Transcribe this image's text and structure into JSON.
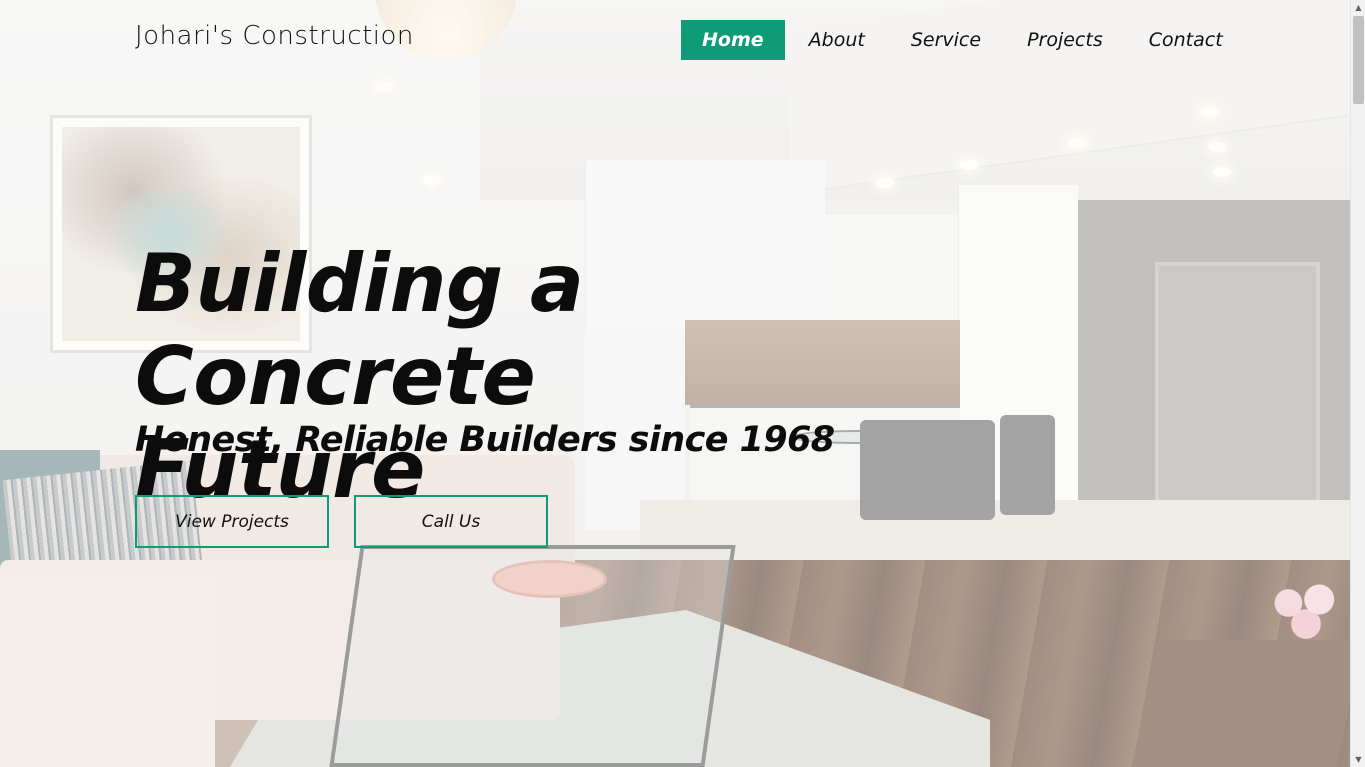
{
  "brand": {
    "name": "Johari's Construction"
  },
  "nav": {
    "items": [
      {
        "label": "Home",
        "active": true
      },
      {
        "label": "About",
        "active": false
      },
      {
        "label": "Service",
        "active": false
      },
      {
        "label": "Projects",
        "active": false
      },
      {
        "label": "Contact",
        "active": false
      }
    ]
  },
  "hero": {
    "headline_line1": "Building a",
    "headline_line2": "Concrete Future",
    "subheadline": "Honest, Reliable Builders since 1968",
    "buttons": {
      "view_projects": "View Projects",
      "call_us": "Call Us"
    },
    "background_image": "modern-apartment-interior-photo"
  },
  "colors": {
    "accent": "#0f9b77",
    "text": "#0c0c0c",
    "nav_active_text": "#ffffff"
  },
  "scrollbar": {
    "up_icon": "triangle-up-icon",
    "down_icon": "triangle-down-icon"
  }
}
